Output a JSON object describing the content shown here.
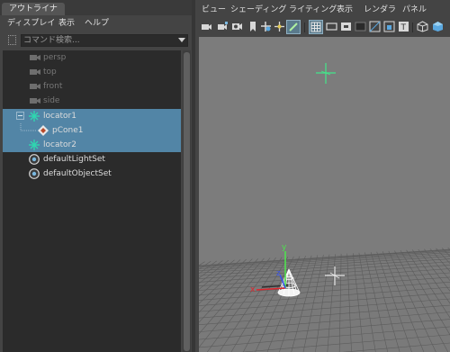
{
  "outliner": {
    "tab_label": "アウトライナ",
    "menu": [
      "ディスプレイ",
      "表示",
      "ヘルプ"
    ],
    "search": {
      "placeholder": "コマンド検索..."
    },
    "items": [
      {
        "label": "persp",
        "icon": "camera-icon",
        "dim": true,
        "selected": false
      },
      {
        "label": "top",
        "icon": "camera-icon",
        "dim": true,
        "selected": false
      },
      {
        "label": "front",
        "icon": "camera-icon",
        "dim": true,
        "selected": false
      },
      {
        "label": "side",
        "icon": "camera-icon",
        "dim": true,
        "selected": false
      },
      {
        "label": "locator1",
        "icon": "locator-icon",
        "dim": false,
        "selected": true,
        "expand": "minus"
      },
      {
        "label": "pCone1",
        "icon": "mesh-icon",
        "dim": false,
        "selected": true,
        "child": true
      },
      {
        "label": "locator2",
        "icon": "locator-icon",
        "dim": false,
        "selected": true
      },
      {
        "label": "defaultLightSet",
        "icon": "set-icon",
        "dim": false,
        "selected": false
      },
      {
        "label": "defaultObjectSet",
        "icon": "set-icon",
        "dim": false,
        "selected": false
      }
    ]
  },
  "viewport": {
    "menu": [
      "ビュー",
      "シェーディング",
      "ライティング",
      "表示",
      "レンダラ",
      "パネル"
    ],
    "toolbar_icons": [
      "camera-select-icon",
      "camera-attributes-icon",
      "bookmark-icon",
      "image-plane-icon",
      "2d-pan-zoom-icon",
      "grease-pencil-icon",
      "grid-icon",
      "film-gate-icon",
      "resolution-gate-icon",
      "gate-mask-icon",
      "field-chart-icon",
      "safe-action-icon",
      "safe-title-icon",
      "wireframe-icon",
      "smooth-shade-icon"
    ],
    "axis_labels": {
      "x": "x",
      "y": "y",
      "z": "z"
    },
    "colors": {
      "background": "#7c7c7c",
      "grid": "#5e5e5e",
      "grid_plane": "#6e6e6e",
      "locator_selected": "#43e68a",
      "locator_unselected": "#e6e6e6",
      "axis_x": "#e0262e",
      "axis_y": "#4fe04f",
      "axis_z": "#3a55e8",
      "cone_wire": "#ffffff",
      "selection": "#5285a6"
    }
  }
}
